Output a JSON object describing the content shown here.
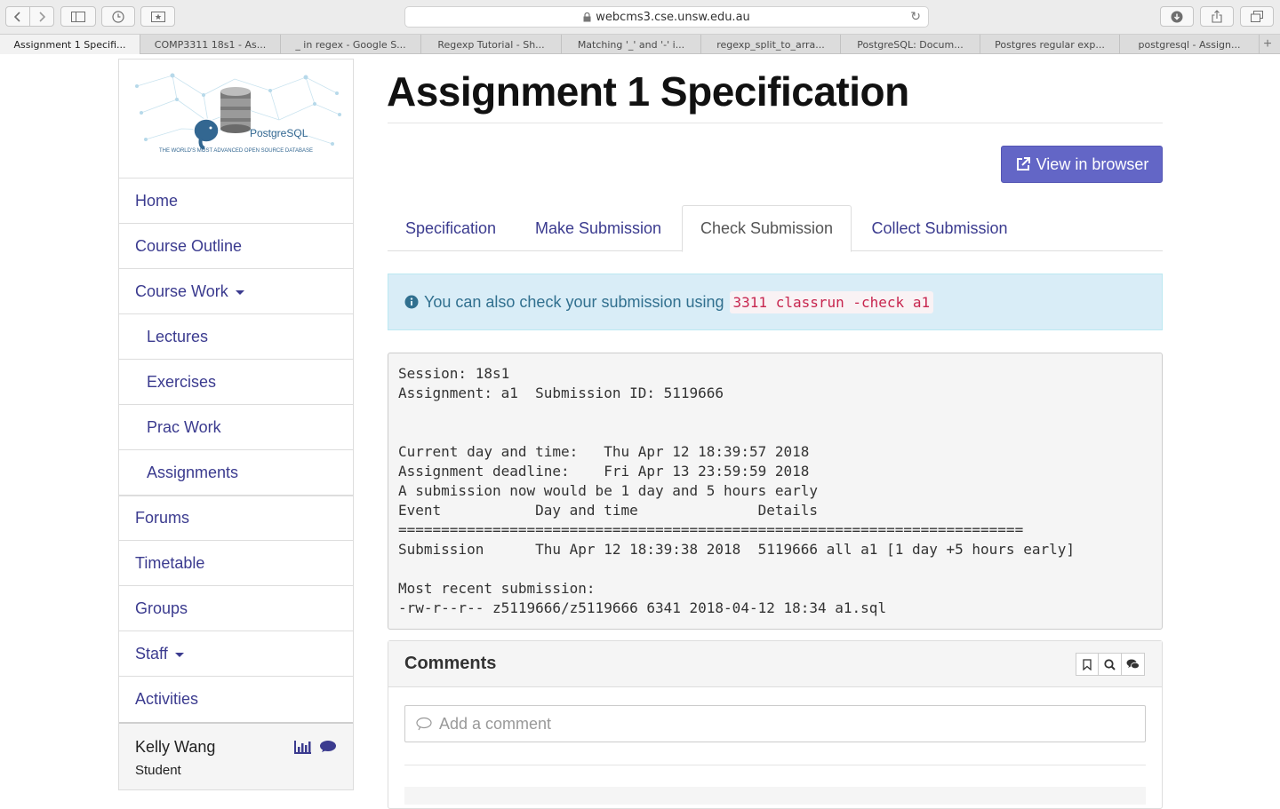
{
  "browser": {
    "url": "webcms3.cse.unsw.edu.au",
    "tabs": [
      "Assignment 1 Specifi...",
      "COMP3311 18s1 - As...",
      "_ in regex - Google S...",
      "Regexp Tutorial - Sh...",
      "Matching '_' and '-' i...",
      "regexp_split_to_arra...",
      "PostgreSQL: Docum...",
      "Postgres regular exp...",
      "postgresql - Assign..."
    ],
    "new_tab_symbol": "+"
  },
  "sidebar": {
    "logo_brand": "PostgreSQL",
    "logo_tagline": "THE WORLD'S MOST ADVANCED OPEN SOURCE DATABASE",
    "items": [
      "Home",
      "Course Outline",
      "Course Work",
      "Lectures",
      "Exercises",
      "Prac Work",
      "Assignments",
      "Forums",
      "Timetable",
      "Groups",
      "Staff",
      "Activities"
    ],
    "user": {
      "name": "Kelly Wang",
      "role": "Student"
    }
  },
  "main": {
    "title": "Assignment 1 Specification",
    "view_button": "View in browser",
    "tabs": [
      "Specification",
      "Make Submission",
      "Check Submission",
      "Collect Submission"
    ],
    "active_tab": "Check Submission",
    "info_text": "You can also check your submission using",
    "info_command": "3311 classrun -check a1",
    "output_lines": [
      "Session: 18s1",
      "Assignment: a1  Submission ID: 5119666",
      "",
      "",
      "Current day and time:   Thu Apr 12 18:39:57 2018",
      "Assignment deadline:    Fri Apr 13 23:59:59 2018",
      "A submission now would be 1 day and 5 hours early",
      "Event           Day and time              Details",
      "=========================================================================",
      "Submission      Thu Apr 12 18:39:38 2018  5119666 all a1 [1 day +5 hours early]",
      "",
      "Most recent submission:",
      "-rw-r--r-- z5119666/z5119666 6341 2018-04-12 18:34 a1.sql"
    ],
    "comments": {
      "title": "Comments",
      "placeholder": "Add a comment"
    }
  },
  "colors": {
    "link": "#3b3b8f",
    "button": "#6366c6",
    "info_bg": "#d9edf7",
    "info_text": "#31708f",
    "code_red": "#c7254e"
  }
}
